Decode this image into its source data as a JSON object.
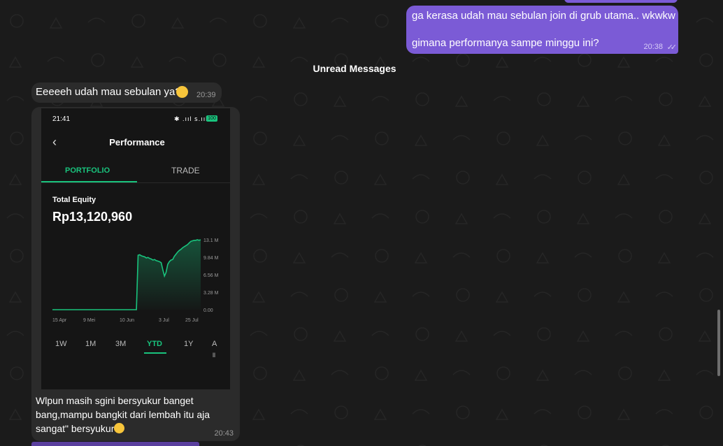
{
  "colors": {
    "outgoing": "#7b5bd6",
    "incoming": "#2b2b2b",
    "accent": "#19c37d",
    "background": "#1b1b1b"
  },
  "outgoing": {
    "line1": "ga kerasa udah mau sebulan join di grub utama.. wkwkw",
    "line2": "gimana performanya sampe minggu ini?",
    "time": "20:38",
    "ticks": "✓✓"
  },
  "unread": "Unread Messages",
  "incoming1": {
    "text": "Eeeeeh udah mau sebulan ya?",
    "time": "20:39",
    "emoji": "grinning-face-icon"
  },
  "screenshot": {
    "status_time": "21:41",
    "status_icons": "✱ .ııl ꜱ.ııl",
    "battery": "100",
    "back_icon": "chevron-left-icon",
    "title": "Performance",
    "tabs": [
      "PORTFOLIO",
      "TRADE"
    ],
    "equity_label": "Total Equity",
    "equity_value": "Rp13,120,960",
    "timeframes": [
      "1W",
      "1M",
      "3M",
      "YTD",
      "1Y",
      "A"
    ],
    "timeframe_extra": "ll"
  },
  "chart_data": {
    "type": "area",
    "x_ticks": [
      "15 Apr",
      "9 Mei",
      "10 Jun",
      "3 Jul",
      "25 Jul"
    ],
    "y_ticks": [
      "13.1 M",
      "9.84 M",
      "6.56 M",
      "3.28 M",
      "0.00"
    ],
    "ylim": [
      0,
      13.1
    ],
    "series": [
      {
        "values": [
          [
            0,
            0
          ],
          [
            1,
            0
          ],
          [
            2,
            0
          ],
          [
            3,
            0
          ],
          [
            4,
            0
          ],
          [
            5,
            0
          ],
          [
            6,
            0
          ],
          [
            7,
            0
          ],
          [
            8,
            0
          ],
          [
            9,
            0
          ],
          [
            10,
            0
          ],
          [
            11,
            0
          ],
          [
            12,
            0
          ],
          [
            13,
            0
          ],
          [
            14,
            0
          ],
          [
            15,
            0
          ],
          [
            16,
            0
          ],
          [
            17,
            0
          ],
          [
            18,
            0
          ],
          [
            19,
            0
          ],
          [
            20,
            0
          ],
          [
            21,
            0
          ],
          [
            22,
            0
          ],
          [
            23,
            0
          ],
          [
            24,
            0
          ],
          [
            25,
            0
          ],
          [
            26,
            0
          ],
          [
            27,
            0
          ],
          [
            28,
            0
          ],
          [
            29,
            0
          ],
          [
            30,
            0
          ],
          [
            31,
            0
          ],
          [
            32,
            0
          ],
          [
            33,
            0
          ],
          [
            34,
            0
          ],
          [
            35,
            0
          ],
          [
            36,
            0
          ],
          [
            37,
            0
          ],
          [
            38,
            0
          ],
          [
            39,
            0
          ],
          [
            40,
            0
          ],
          [
            41,
            0
          ],
          [
            42,
            0
          ],
          [
            43,
            0
          ],
          [
            44,
            0
          ],
          [
            45,
            0
          ],
          [
            46,
            0
          ],
          [
            47,
            0
          ],
          [
            48,
            0
          ],
          [
            49,
            0
          ],
          [
            50,
            0
          ],
          [
            51,
            0
          ],
          [
            52,
            10.2
          ],
          [
            53,
            10.3
          ],
          [
            54,
            10.1
          ],
          [
            55,
            10
          ],
          [
            56,
            9.9
          ],
          [
            57,
            9.7
          ],
          [
            58,
            9.8
          ],
          [
            59,
            9.6
          ],
          [
            60,
            9.5
          ],
          [
            61,
            9.3
          ],
          [
            62,
            9.4
          ],
          [
            63,
            9.2
          ],
          [
            64,
            9.1
          ],
          [
            65,
            9.0
          ],
          [
            66,
            8.8
          ],
          [
            67,
            7.5
          ],
          [
            68,
            6.3
          ],
          [
            69,
            7.0
          ],
          [
            70,
            8.5
          ],
          [
            71,
            9.0
          ],
          [
            72,
            9.3
          ],
          [
            73,
            9.4
          ],
          [
            74,
            10.0
          ],
          [
            75,
            10.4
          ],
          [
            76,
            10.8
          ],
          [
            77,
            11.1
          ],
          [
            78,
            11.3
          ],
          [
            79,
            11.6
          ],
          [
            80,
            11.8
          ],
          [
            81,
            12.0
          ],
          [
            82,
            12.2
          ],
          [
            83,
            12.5
          ],
          [
            84,
            12.8
          ],
          [
            85,
            12.9
          ],
          [
            86,
            13.0
          ],
          [
            87,
            13.0
          ],
          [
            88,
            13.1
          ],
          [
            89,
            13.0
          ],
          [
            90,
            13.1
          ]
        ]
      }
    ]
  },
  "incoming2": {
    "message": "Wlpun masih sgini bersyukur banget bang,mampu bangkit dari lembah itu aja sangat\" bersyukur",
    "time": "20:43",
    "emoji": "grinning-face-icon"
  }
}
